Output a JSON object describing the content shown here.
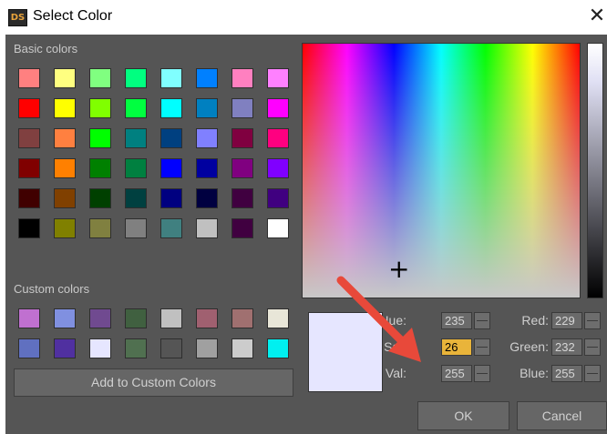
{
  "window": {
    "title": "Select Color",
    "icon_text": "DS",
    "close_glyph": "✕"
  },
  "basic_colors": {
    "label": "Basic colors",
    "rows": [
      [
        "#ff8080",
        "#ffff80",
        "#80ff80",
        "#00ff80",
        "#80ffff",
        "#0080ff",
        "#ff80c0",
        "#ff80ff"
      ],
      [
        "#ff0000",
        "#ffff00",
        "#80ff00",
        "#00ff40",
        "#00ffff",
        "#0080c0",
        "#8080c0",
        "#ff00ff"
      ],
      [
        "#804040",
        "#ff8040",
        "#00ff00",
        "#008080",
        "#004080",
        "#8080ff",
        "#800040",
        "#ff0080"
      ],
      [
        "#800000",
        "#ff8000",
        "#008000",
        "#008040",
        "#0000ff",
        "#0000a0",
        "#800080",
        "#8000ff"
      ],
      [
        "#400000",
        "#804000",
        "#004000",
        "#004040",
        "#000080",
        "#000040",
        "#400040",
        "#400080"
      ],
      [
        "#000000",
        "#808000",
        "#808040",
        "#808080",
        "#408080",
        "#c0c0c0",
        "#400040",
        "#ffffff"
      ]
    ]
  },
  "custom_colors": {
    "label": "Custom colors",
    "rows": [
      [
        "#c070d0",
        "#8090e0",
        "#704a90",
        "#406040",
        "#c0c0c0",
        "#a06070",
        "#a07070",
        "#e8e6d8"
      ],
      [
        "#6070c0",
        "#5030a0",
        "#e6e6ff",
        "#507050",
        "#555555",
        "#a0a0a0",
        "#cccccc",
        "#00f0f0"
      ]
    ]
  },
  "add_button": "Add to Custom Colors",
  "current_color": "#e6e6ff",
  "fields": {
    "hue": {
      "label": "Hue:",
      "value": "235"
    },
    "sat": {
      "label": "Sat:",
      "value": "26"
    },
    "val": {
      "label": "Val:",
      "value": "255"
    },
    "red": {
      "label": "Red:",
      "value": "229"
    },
    "green": {
      "label": "Green:",
      "value": "232"
    },
    "blue": {
      "label": "Blue:",
      "value": "255"
    }
  },
  "buttons": {
    "ok": "OK",
    "cancel": "Cancel"
  },
  "colors": {
    "dialog_bg": "#555555",
    "active_field": "#e9b43a",
    "arrow": "#e8493a"
  }
}
